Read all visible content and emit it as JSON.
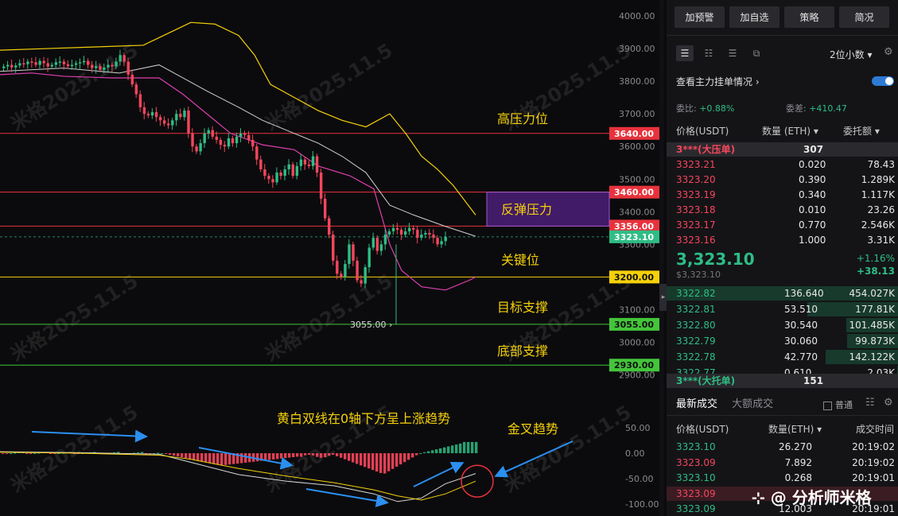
{
  "watermark": "米格2025.11.5",
  "price_axis": {
    "ticks": [
      "4000.00",
      "3900.00",
      "3800.00",
      "3700.00",
      "3600.00",
      "3500.00",
      "3400.00",
      "3300.00",
      "3200.00",
      "3100.00",
      "3000.00",
      "2900.00"
    ]
  },
  "macd_axis": {
    "ticks": [
      "50.00",
      "0.00",
      "-50.00",
      "-100.00"
    ]
  },
  "levels": [
    {
      "price": "3640.00",
      "label": "高压力位",
      "color": "#e8323c"
    },
    {
      "price": "3460.00",
      "label": "",
      "color": "#e8323c"
    },
    {
      "price": "3356.00",
      "label": "",
      "color": "#e8323c"
    },
    {
      "price": "3323.10",
      "label": "",
      "color": "#2ebd85"
    },
    {
      "price": "3200.00",
      "label": "关键位",
      "color": "#f5d10a"
    },
    {
      "price": "3055.00",
      "label": "目标支撑",
      "color": "#43c53a"
    },
    {
      "price": "2930.00",
      "label": "底部支撑",
      "color": "#43c53a"
    }
  ],
  "annotations": {
    "rebound_box": "反弹压力",
    "low_marker": "3055.00",
    "macd_note": "黄白双线在0轴下方呈上涨趋势",
    "golden_cross": "金叉趋势"
  },
  "panel": {
    "buttons": [
      "加预警",
      "加自选",
      "策略",
      "简况"
    ],
    "decimals": "2位小数 ▾",
    "mainforce": "查看主力挂单情况 ›",
    "ratio_label": "委比:",
    "ratio_value": "+0.88%",
    "diff_label": "委差:",
    "diff_value": "+410.47",
    "headers": [
      "价格(USDT)",
      "数量 (ETH) ▾",
      "委托额 ▾"
    ],
    "big_ask": {
      "name": "3***(大压单)",
      "qty": "307"
    },
    "asks": [
      {
        "price": "3323.21",
        "qty": "0.020",
        "amt": "78.43"
      },
      {
        "price": "3323.20",
        "qty": "0.390",
        "amt": "1.289K"
      },
      {
        "price": "3323.19",
        "qty": "0.340",
        "amt": "1.117K"
      },
      {
        "price": "3323.18",
        "qty": "0.010",
        "amt": "23.26"
      },
      {
        "price": "3323.17",
        "qty": "0.770",
        "amt": "2.546K"
      },
      {
        "price": "3323.16",
        "qty": "1.000",
        "amt": "3.31K"
      }
    ],
    "last_price": "3,323.10",
    "last_sub": "$3,323.10",
    "change_pct": "+1.16%",
    "change_abs": "+38.13",
    "bids": [
      {
        "price": "3322.82",
        "qty": "136.640",
        "amt": "454.027K"
      },
      {
        "price": "3322.81",
        "qty": "53.510",
        "amt": "177.81K"
      },
      {
        "price": "3322.80",
        "qty": "30.540",
        "amt": "101.485K"
      },
      {
        "price": "3322.79",
        "qty": "30.060",
        "amt": "99.873K"
      },
      {
        "price": "3322.78",
        "qty": "42.770",
        "amt": "142.122K"
      },
      {
        "price": "3322.77",
        "qty": "0.610",
        "amt": "2.03K"
      }
    ],
    "big_bid": {
      "name": "3***(大托单)",
      "qty": "151"
    },
    "tabs": [
      "最新成交",
      "大额成交"
    ],
    "normal_label": "普通",
    "trade_headers": [
      "价格(USDT)",
      "数量(ETH) ▾",
      "成交时间"
    ],
    "trades": [
      {
        "price": "3323.10",
        "qty": "26.270",
        "time": "20:19:02",
        "side": "buy"
      },
      {
        "price": "3323.09",
        "qty": "7.892",
        "time": "20:19:02",
        "side": "sell"
      },
      {
        "price": "3323.10",
        "qty": "0.268",
        "time": "20:19:01",
        "side": "buy"
      },
      {
        "price": "3323.09",
        "qty": "",
        "time": "",
        "side": "sell"
      },
      {
        "price": "3323.09",
        "qty": "12.003",
        "time": "20:19:01",
        "side": "buy"
      }
    ],
    "author": "分析师米格"
  }
}
